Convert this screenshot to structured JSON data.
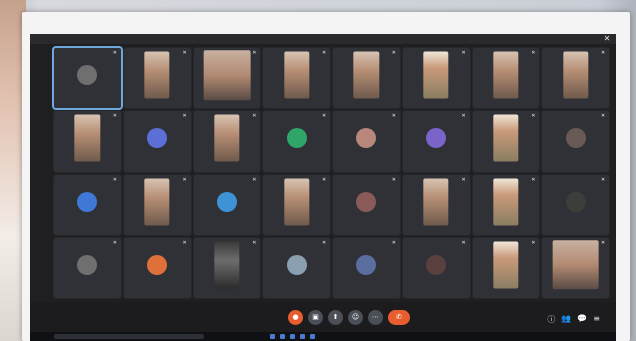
{
  "window": {
    "close_icon": "close-icon"
  },
  "participants": [
    {
      "name": "",
      "kind": "avatar",
      "color": "#6f6f6f",
      "initial": ""
    },
    {
      "name": "",
      "kind": "video"
    },
    {
      "name": "",
      "kind": "video-wide"
    },
    {
      "name": "",
      "kind": "video"
    },
    {
      "name": "",
      "kind": "video"
    },
    {
      "name": "",
      "kind": "video-uniform"
    },
    {
      "name": "",
      "kind": "video"
    },
    {
      "name": "",
      "kind": "video"
    },
    {
      "name": "",
      "kind": "video"
    },
    {
      "name": "",
      "kind": "avatar",
      "color": "#5b6fd6",
      "initial": ""
    },
    {
      "name": "",
      "kind": "video"
    },
    {
      "name": "",
      "kind": "avatar",
      "color": "#2fa56a",
      "initial": ""
    },
    {
      "name": "",
      "kind": "avatar",
      "color": "#b8867b",
      "initial": ""
    },
    {
      "name": "",
      "kind": "avatar",
      "color": "#7a64c9",
      "initial": ""
    },
    {
      "name": "",
      "kind": "video-uniform"
    },
    {
      "name": "",
      "kind": "avatar",
      "color": "#6a5a55",
      "initial": ""
    },
    {
      "name": "",
      "kind": "avatar",
      "color": "#3f78d6",
      "initial": ""
    },
    {
      "name": "",
      "kind": "video"
    },
    {
      "name": "",
      "kind": "avatar",
      "color": "#3d93d6",
      "initial": ""
    },
    {
      "name": "",
      "kind": "video"
    },
    {
      "name": "",
      "kind": "avatar",
      "color": "#8a5a5a",
      "initial": ""
    },
    {
      "name": "",
      "kind": "video"
    },
    {
      "name": "",
      "kind": "video-uniform"
    },
    {
      "name": "",
      "kind": "avatar",
      "color": "#3a3f3a",
      "initial": ""
    },
    {
      "name": "",
      "kind": "avatar",
      "color": "#6f6f6f",
      "initial": ""
    },
    {
      "name": "",
      "kind": "avatar",
      "color": "#e0703a",
      "initial": ""
    },
    {
      "name": "",
      "kind": "video-dark"
    },
    {
      "name": "",
      "kind": "avatar",
      "color": "#8aa0b0",
      "initial": ""
    },
    {
      "name": "",
      "kind": "avatar",
      "color": "#5a6fa0",
      "initial": ""
    },
    {
      "name": "",
      "kind": "avatar",
      "color": "#5a3f3f",
      "initial": ""
    },
    {
      "name": "",
      "kind": "video-uniform"
    },
    {
      "name": "",
      "kind": "video-wide"
    }
  ],
  "controlbar": {
    "meeting_info": "",
    "buttons": [
      {
        "name": "mic-toggle",
        "color": "#e85d2e",
        "glyph": "●"
      },
      {
        "name": "camera-toggle",
        "color": "#4b4f58",
        "glyph": "▣"
      },
      {
        "name": "share-screen",
        "color": "#4b4f58",
        "glyph": "⬆"
      },
      {
        "name": "reactions",
        "color": "#4b4f58",
        "glyph": "☺"
      },
      {
        "name": "more-options",
        "color": "#4b4f58",
        "glyph": "⋯"
      }
    ],
    "end_glyph": "✆",
    "right_icons": [
      "ⓘ",
      "👥",
      "💬",
      "≡"
    ]
  },
  "taskbar": {
    "tray": ""
  }
}
